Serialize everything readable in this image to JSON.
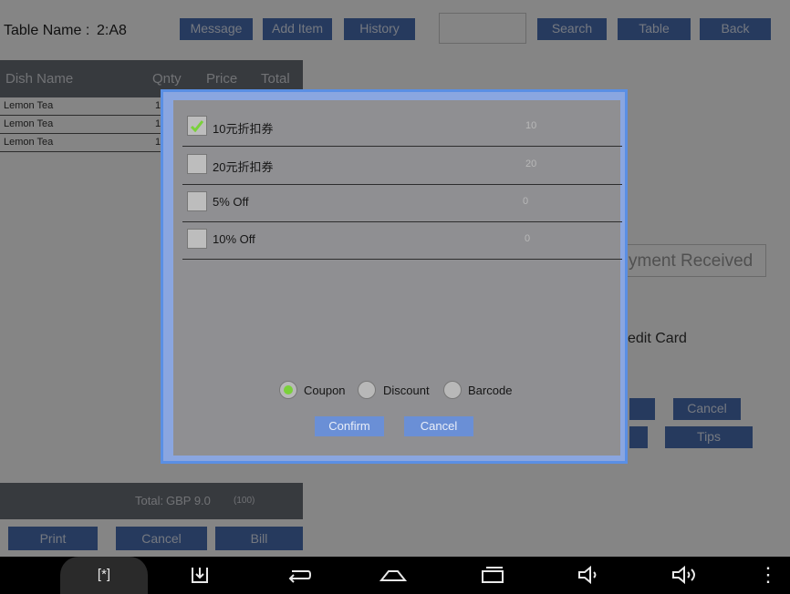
{
  "header": {
    "table_label": "Table Name :",
    "table_value": "2:A8",
    "buttons": {
      "message": "Message",
      "add_item": "Add Item",
      "history": "History",
      "search": "Search",
      "table": "Table",
      "back": "Back"
    },
    "search_value": ""
  },
  "order_table": {
    "columns": [
      "Dish Name",
      "Qnty",
      "Price",
      "Total"
    ],
    "rows": [
      {
        "name": "Lemon Tea",
        "qty": "1"
      },
      {
        "name": "Lemon Tea",
        "qty": "1"
      },
      {
        "name": "Lemon Tea",
        "qty": "1"
      }
    ],
    "total_label": "Total:",
    "total_value": "GBP 9.0",
    "total_count": "(100)"
  },
  "footer_buttons": {
    "print": "Print",
    "cancel": "Cancel",
    "bill": "Bill"
  },
  "right_panel": {
    "payment_received_placeholder": "yment Received",
    "credit_card_label": "edit Card",
    "cancel": "Cancel",
    "tips": "Tips"
  },
  "modal": {
    "options": [
      {
        "label": "10元折扣券",
        "value": "10",
        "checked": true
      },
      {
        "label": "20元折扣券",
        "value": "20",
        "checked": false
      },
      {
        "label": "5% Off",
        "value": "0",
        "checked": false
      },
      {
        "label": "10% Off",
        "value": "0",
        "checked": false
      }
    ],
    "radios": [
      {
        "label": "Coupon",
        "selected": true
      },
      {
        "label": "Discount",
        "selected": false
      },
      {
        "label": "Barcode",
        "selected": false
      }
    ],
    "confirm": "Confirm",
    "cancel": "Cancel"
  },
  "nav_icons": [
    "screenshot-icon",
    "download-icon",
    "back-icon",
    "home-icon",
    "recent-apps-icon",
    "volume-down-icon",
    "volume-up-icon",
    "menu-icon"
  ],
  "colors": {
    "accent_button": "#4a6fb4",
    "modal_border": "#5a8fe4",
    "check_green": "#7ad13a"
  }
}
